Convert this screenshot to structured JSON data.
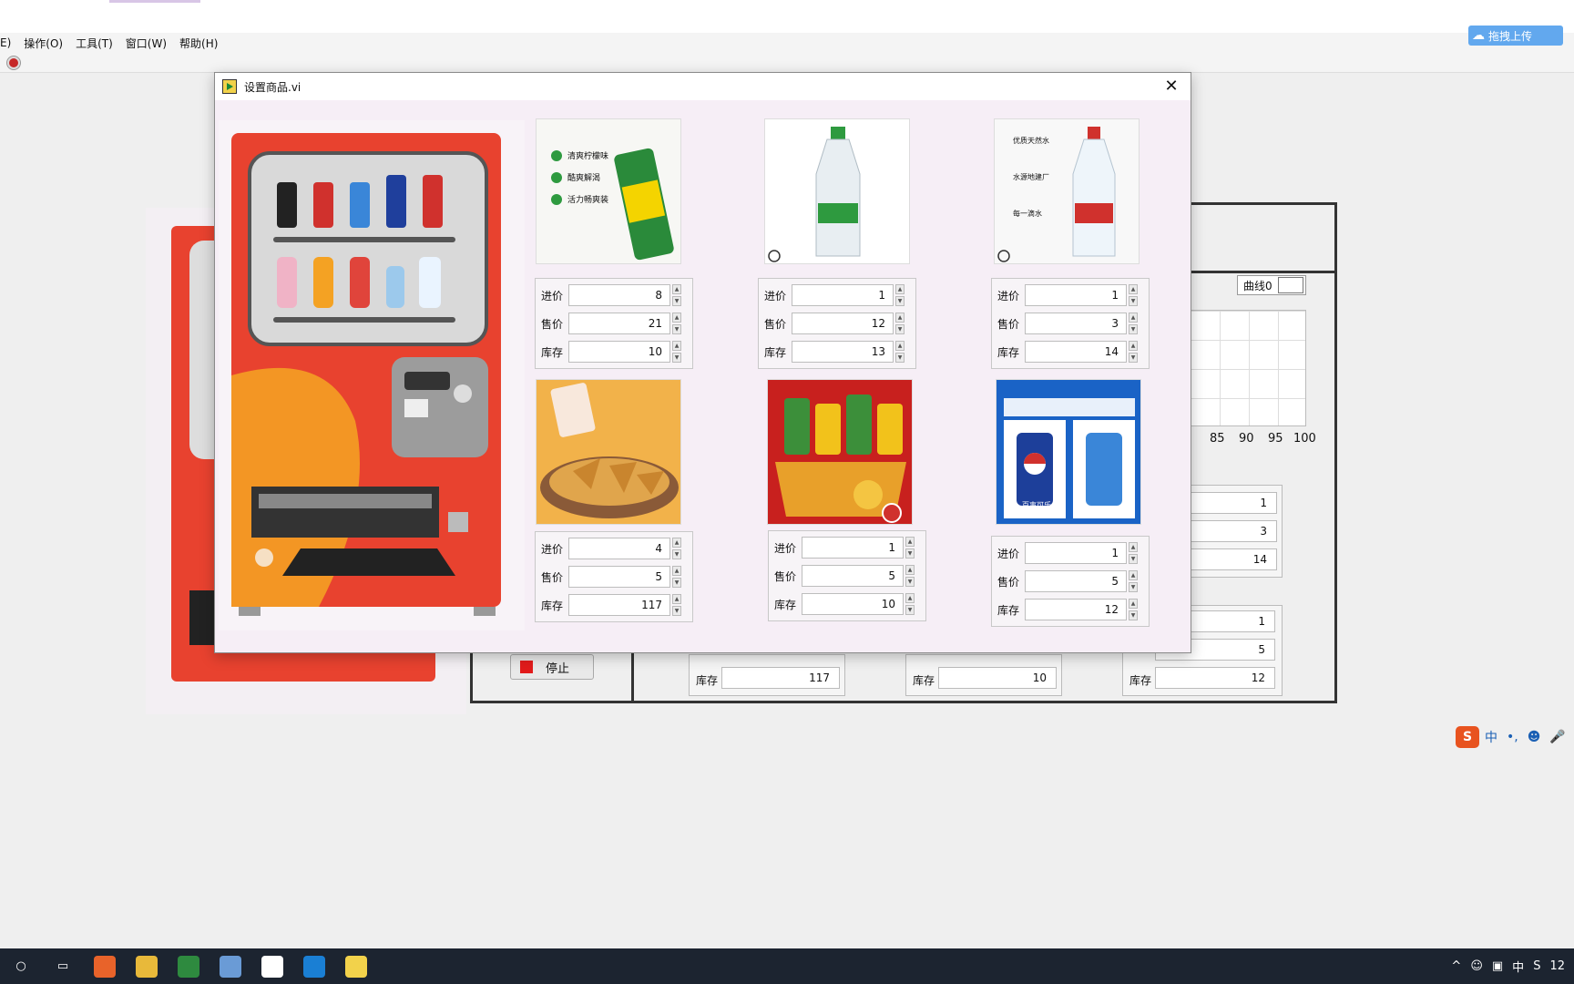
{
  "menubar": {
    "items": [
      "E)",
      "操作(O)",
      "工具(T)",
      "窗口(W)",
      "帮助(H)"
    ]
  },
  "upload_button": {
    "label": "拖拽上传"
  },
  "background_panel": {
    "graph_legend": "曲线0",
    "x_ticks": [
      "85",
      "90",
      "95",
      "100"
    ],
    "stop_button": "停止",
    "column1": {
      "values": [
        "1",
        "3",
        "14"
      ]
    },
    "column2": {
      "values": [
        "1",
        "5",
        "12"
      ]
    },
    "bottom_row": [
      {
        "label": "库存",
        "value": "117"
      },
      {
        "label": "库存",
        "value": "10"
      },
      {
        "label": "库存",
        "value": "12"
      }
    ]
  },
  "dialog": {
    "title": "设置商品.vi",
    "field_labels": {
      "cost": "进价",
      "price": "售价",
      "stock": "库存"
    },
    "products": [
      {
        "image": "sprite-can",
        "img_text": [
          "清爽柠檬味",
          "酷爽解渴",
          "活力畅爽装"
        ],
        "cost": "8",
        "price": "21",
        "stock": "10"
      },
      {
        "image": "water-bottle-green",
        "cost": "1",
        "price": "12",
        "stock": "13"
      },
      {
        "image": "nongfu-spring-bottle",
        "img_text": [
          "优质天然水",
          "水源地建厂",
          "每一滴水"
        ],
        "cost": "1",
        "price": "3",
        "stock": "14"
      },
      {
        "image": "tortilla-chips",
        "cost": "4",
        "price": "5",
        "stock": "117"
      },
      {
        "image": "lays-chips-gift-box",
        "cost": "1",
        "price": "5",
        "stock": "10"
      },
      {
        "image": "pepsi-cans",
        "img_text": [
          "百事可乐"
        ],
        "cost": "1",
        "price": "5",
        "stock": "12"
      }
    ]
  },
  "taskbar": {
    "tray_text": [
      "中",
      "12"
    ]
  },
  "ime": {
    "logo": "S",
    "mode": "中"
  }
}
